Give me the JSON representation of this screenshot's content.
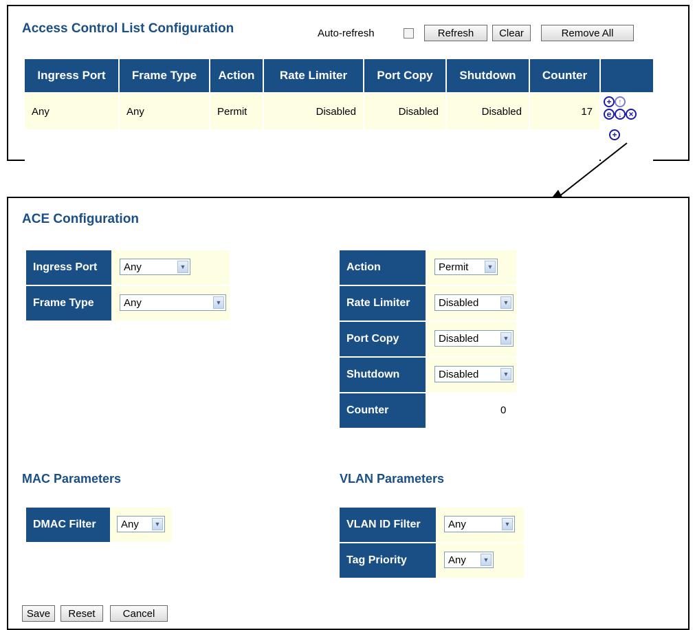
{
  "acl": {
    "title": "Access Control List Configuration",
    "auto_refresh_label": "Auto-refresh",
    "auto_refresh_checked": false,
    "buttons": {
      "refresh": "Refresh",
      "clear": "Clear",
      "remove_all": "Remove All"
    },
    "columns": [
      "Ingress Port",
      "Frame Type",
      "Action",
      "Rate Limiter",
      "Port Copy",
      "Shutdown",
      "Counter",
      ""
    ],
    "rows": [
      {
        "ingress_port": "Any",
        "frame_type": "Any",
        "action": "Permit",
        "rate_limiter": "Disabled",
        "port_copy": "Disabled",
        "shutdown": "Disabled",
        "counter": "17"
      }
    ],
    "icons": [
      "insert-icon",
      "move-up-icon",
      "edit-icon",
      "move-down-icon",
      "delete-icon",
      "add-icon"
    ],
    "icon_glyphs": {
      "plus": "+",
      "up": "↑",
      "edit": "e",
      "down": "↓",
      "del": "×"
    }
  },
  "ace": {
    "title": "ACE Configuration",
    "fields": {
      "ingress_port": {
        "label": "Ingress Port",
        "value": "Any"
      },
      "frame_type": {
        "label": "Frame Type",
        "value": "Any"
      },
      "action": {
        "label": "Action",
        "value": "Permit"
      },
      "rate_limiter": {
        "label": "Rate Limiter",
        "value": "Disabled"
      },
      "port_copy": {
        "label": "Port Copy",
        "value": "Disabled"
      },
      "shutdown": {
        "label": "Shutdown",
        "value": "Disabled"
      },
      "counter": {
        "label": "Counter",
        "value": "0"
      }
    },
    "mac": {
      "title": "MAC Parameters",
      "dmac_filter": {
        "label": "DMAC Filter",
        "value": "Any"
      }
    },
    "vlan": {
      "title": "VLAN Parameters",
      "vlan_id_filter": {
        "label": "VLAN ID Filter",
        "value": "Any"
      },
      "tag_priority": {
        "label": "Tag Priority",
        "value": "Any"
      }
    },
    "buttons": {
      "save": "Save",
      "reset": "Reset",
      "cancel": "Cancel"
    }
  },
  "colors": {
    "header": "#1a4f86",
    "row_bg": "#fefee3",
    "icon": "#1a1aa6"
  }
}
